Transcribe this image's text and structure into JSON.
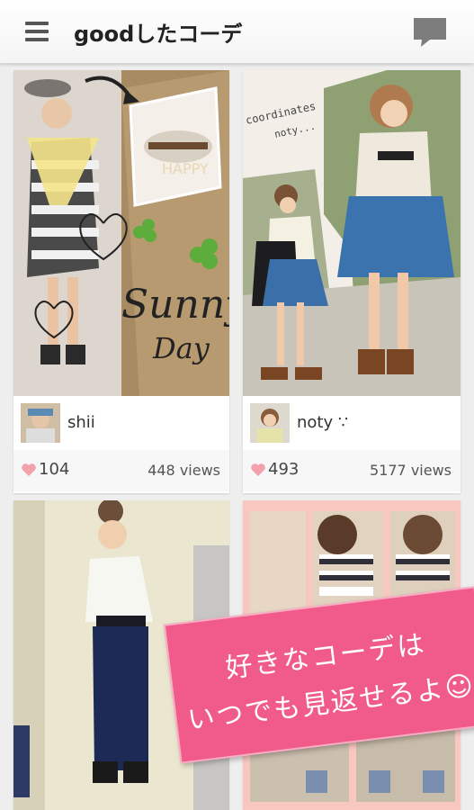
{
  "appbar": {
    "title": "goodしたコーデ",
    "menu_icon": "hamburger-menu-icon",
    "chat_icon": "chat-bubble-icon"
  },
  "posts": [
    {
      "username": "shii",
      "likes": "104",
      "views": "448 views",
      "photo_text_1": "Sunny",
      "photo_text_2": "Day",
      "photo_text_3": "HAPPY"
    },
    {
      "username": "noty ∵",
      "likes": "493",
      "views": "5177 views",
      "photo_text_1": "coordinates",
      "photo_text_2": "noty..."
    },
    {
      "username": "",
      "likes": "",
      "views": ""
    },
    {
      "username": "",
      "likes": "",
      "views": ""
    }
  ],
  "banner": {
    "line1": "好きなコーデは",
    "line2": "いつでも見返せるよ☺"
  },
  "colors": {
    "heart": "#f2a1ad",
    "banner": "#f05b8a",
    "appbar": "#f6f6f6"
  }
}
